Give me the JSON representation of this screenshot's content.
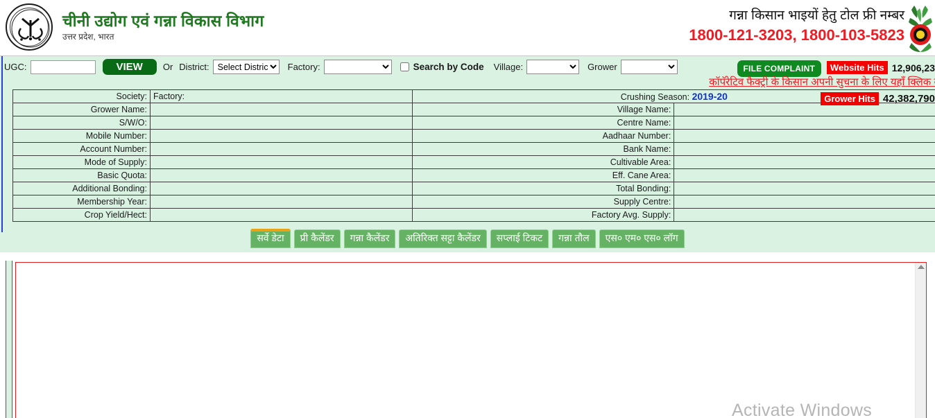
{
  "header": {
    "dept_title": "चीनी उद्योग एवं गन्ना विकास विभाग",
    "dept_subtitle": "उत्तर प्रदेश, भारत",
    "tollfree_label": "गन्ना किसान भाइयों हेतु टोल फ्री नम्बर",
    "tollfree_numbers": "1800-121-3203, 1800-103-5823",
    "emblem_name": "uttar-pradesh-government-emblem",
    "cane_emblem_name": "sugarcane-emblem"
  },
  "colors": {
    "brand_green": "#1e7a1e",
    "accent_red": "#ee1c24",
    "panel_mint": "#d9f2e2",
    "button_green": "#0a6b17",
    "tab_green": "#65b265",
    "active_tab_bar": "#e8a317",
    "season_blue": "#1034c8"
  },
  "search": {
    "ugc_label": "UGC:",
    "ugc_value": "",
    "ugc_placeholder": "",
    "view_button": "VIEW",
    "or_text": "Or",
    "district_label": "District:",
    "district_selected": "Select District",
    "district_options": [
      "Select District"
    ],
    "factory_label": "Factory:",
    "factory_selected": "",
    "factory_options": [
      ""
    ],
    "search_by_code_label": "Search by Code",
    "search_by_code_checked": false,
    "village_label": "Village:",
    "village_selected": "",
    "village_options": [
      ""
    ],
    "grower_label": "Grower",
    "grower_selected": "",
    "grower_options": [
      ""
    ],
    "file_complaint_button": "FILE COMPLAINT",
    "website_hits_tag": "Website Hits",
    "website_hits_value": "12,906,23",
    "coop_link": "कॉपॅरेटिव फैक्ट्री के किसान अपनी सुचना के लिए यहाँ क्लिक क",
    "grower_hits_tag": "Grower Hits",
    "grower_hits_value": "42,382,790"
  },
  "details": {
    "top_row": {
      "society_label": "Society:",
      "society_value": "",
      "factory_label": "Factory:",
      "factory_value": "",
      "season_label": "Crushing Season:",
      "season_value": "2019-20"
    },
    "rows": [
      {
        "left_label": "Grower Name:",
        "left_value": "",
        "right_label": "Village Name:",
        "right_value": ""
      },
      {
        "left_label": "S/W/O:",
        "left_value": "",
        "right_label": "Centre Name:",
        "right_value": ""
      },
      {
        "left_label": "Mobile Number:",
        "left_value": "",
        "right_label": "Aadhaar Number:",
        "right_value": ""
      },
      {
        "left_label": "Account Number:",
        "left_value": "",
        "right_label": "Bank Name:",
        "right_value": ""
      },
      {
        "left_label": "Mode of Supply:",
        "left_value": "",
        "right_label": "Cultivable Area:",
        "right_value": ""
      },
      {
        "left_label": "Basic Quota:",
        "left_value": "",
        "right_label": "Eff. Cane Area:",
        "right_value": ""
      },
      {
        "left_label": "Additional Bonding:",
        "left_value": "",
        "right_label": "Total Bonding:",
        "right_value": ""
      },
      {
        "left_label": "Membership Year:",
        "left_value": "",
        "right_label": "Supply Centre:",
        "right_value": ""
      },
      {
        "left_label": "Crop Yield/Hect:",
        "left_value": "",
        "right_label": "Factory Avg. Supply:",
        "right_value": ""
      }
    ]
  },
  "tabs": [
    {
      "label": "सर्वे डेटा",
      "active": true
    },
    {
      "label": "प्री कैलेंडर",
      "active": false
    },
    {
      "label": "गन्ना कैलेंडर",
      "active": false
    },
    {
      "label": "अतिरिक्त सट्टा कैलेंडर",
      "active": false
    },
    {
      "label": "सप्लाई टिकट",
      "active": false
    },
    {
      "label": "गन्ना तौल",
      "active": false
    },
    {
      "label": "एस० एम० एस० लॉग",
      "active": false
    }
  ],
  "content": {
    "body_text": "",
    "scroll_up_icon": "scroll-up-arrow-icon"
  },
  "watermark": {
    "text": "Activate Windows"
  }
}
